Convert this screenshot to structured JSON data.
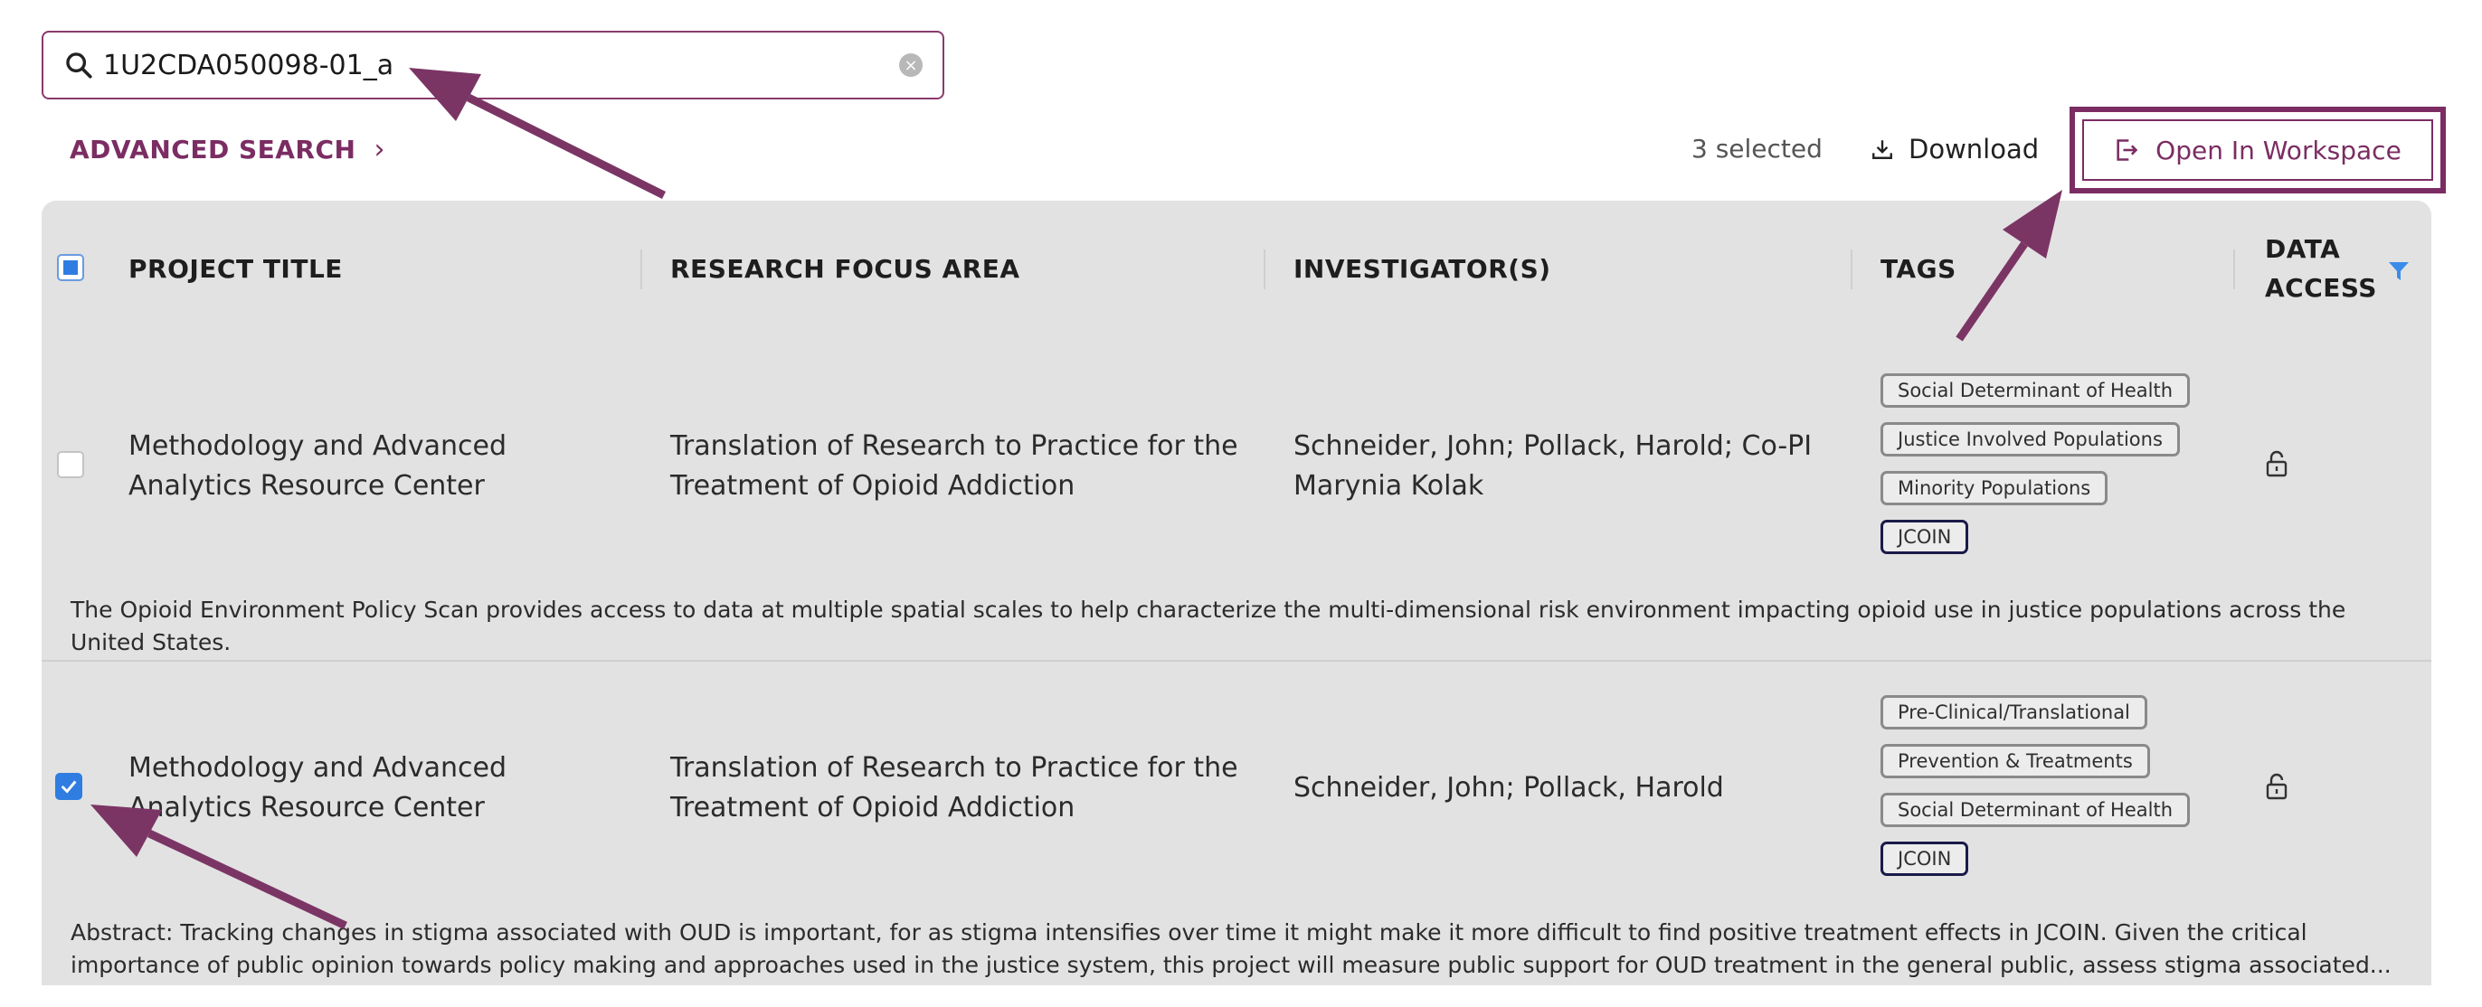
{
  "search": {
    "value": "1U2CDA050098-01_a"
  },
  "toolbar": {
    "advanced_search_label": "ADVANCED SEARCH",
    "selected_count": "3 selected",
    "download_label": "Download",
    "open_workspace_label": "Open In Workspace"
  },
  "table": {
    "headers": {
      "project_title": "PROJECT TITLE",
      "research_focus": "RESEARCH FOCUS AREA",
      "investigators": "INVESTIGATOR(S)",
      "tags": "TAGS",
      "data_access_1": "DATA",
      "data_access_2": "ACCESS"
    },
    "rows": [
      {
        "checked": false,
        "title_line1": "Methodology and Advanced",
        "title_line2": "Analytics Resource Center",
        "focus_line1": "Translation of Research to Practice for the",
        "focus_line2": "Treatment of Opioid Addiction",
        "investigators_line1": "Schneider, John; Pollack, Harold; Co-PI",
        "investigators_line2": "Marynia Kolak",
        "tags": [
          "Social Determinant of Health",
          "Justice Involved Populations",
          "Minority Populations",
          "JCOIN"
        ],
        "description": "The Opioid Environment Policy Scan provides access to data at multiple spatial scales to help characterize the multi-dimensional risk environment impacting opioid use in justice populations across the",
        "description_line2": "United States."
      },
      {
        "checked": true,
        "title_line1": "Methodology and Advanced",
        "title_line2": "Analytics Resource Center",
        "focus_line1": "Translation of Research to Practice for the",
        "focus_line2": "Treatment of Opioid Addiction",
        "investigators_line1": "Schneider, John; Pollack, Harold",
        "tags": [
          "Pre-Clinical/Translational",
          "Prevention & Treatments",
          "Social Determinant of Health",
          "JCOIN"
        ],
        "description": "Abstract: Tracking changes in stigma associated with OUD is important, for as stigma intensifies over time it might make it more difficult to find positive treatment effects in JCOIN. Given the critical",
        "description_line2": "importance of public opinion towards policy making and approaches used in the justice system, this project will measure public support for OUD treatment in the general public, assess stigma associated..."
      }
    ]
  },
  "colors": {
    "accent": "#7b2d63",
    "checkbox": "#2f7de1",
    "table_bg": "#e2e2e2",
    "annotation_arrow": "#7b3565"
  },
  "icons": {
    "search": "search-icon",
    "clear": "clear-icon",
    "download": "download-icon",
    "workspace": "open-workspace-icon",
    "filter": "filter-icon",
    "lock": "unlocked-lock-icon"
  }
}
